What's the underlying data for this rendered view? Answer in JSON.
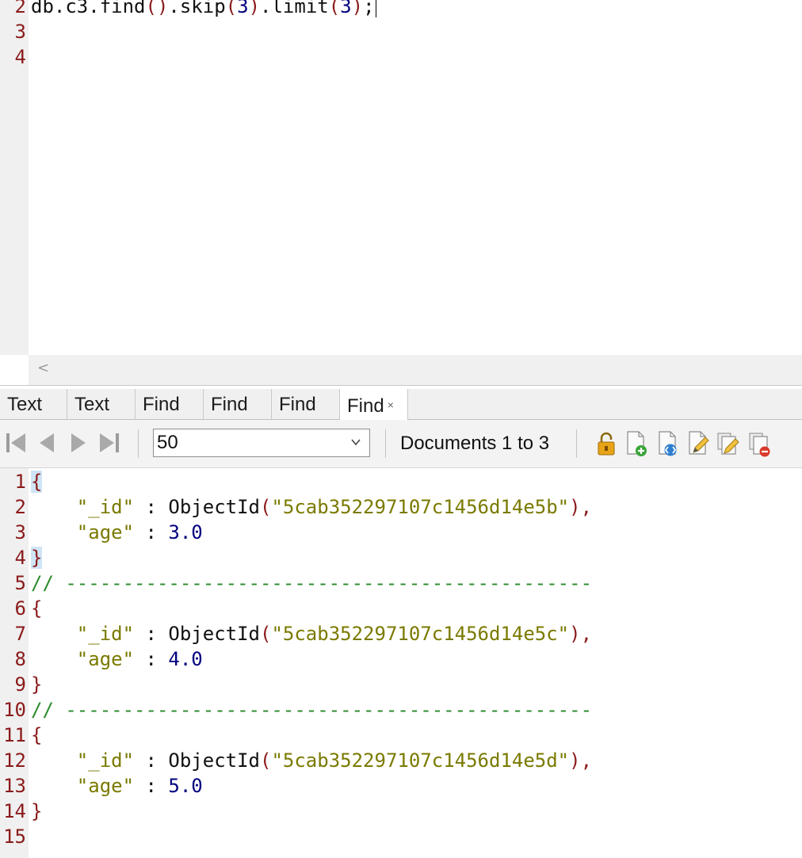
{
  "editor": {
    "lines": [
      {
        "num": "2",
        "parts": [
          {
            "t": "db.c3.find",
            "c": "fn"
          },
          {
            "t": "()",
            "c": "paren"
          },
          {
            "t": ".skip",
            "c": "fn"
          },
          {
            "t": "(",
            "c": "paren"
          },
          {
            "t": "3",
            "c": "num"
          },
          {
            "t": ")",
            "c": "paren"
          },
          {
            "t": ".limit",
            "c": "fn"
          },
          {
            "t": "(",
            "c": "paren"
          },
          {
            "t": "3",
            "c": "num"
          },
          {
            "t": ")",
            "c": "paren"
          },
          {
            "t": ";",
            "c": "punc"
          }
        ]
      },
      {
        "num": "3",
        "parts": []
      },
      {
        "num": "4",
        "parts": []
      }
    ],
    "scroll_left_icon": "chevron-left-icon"
  },
  "tabs": [
    {
      "label": "Text",
      "active": false
    },
    {
      "label": "Text",
      "active": false
    },
    {
      "label": "Find",
      "active": false
    },
    {
      "label": "Find",
      "active": false
    },
    {
      "label": "Find",
      "active": false
    },
    {
      "label": "Find",
      "active": true,
      "close": "×"
    }
  ],
  "toolbar": {
    "nav_icons": [
      "first-page-icon",
      "previous-page-icon",
      "next-page-icon",
      "last-page-icon"
    ],
    "page_size": "50",
    "documents_label": "Documents 1 to 3",
    "action_icons": [
      "lock-icon",
      "add-document-icon",
      "view-document-icon",
      "edit-document-icon",
      "edit-multiple-icon",
      "delete-document-icon"
    ]
  },
  "results": {
    "lines": [
      {
        "num": "1",
        "parts": [
          {
            "t": "{",
            "c": "brace hl"
          }
        ]
      },
      {
        "num": "2",
        "parts": [
          {
            "t": "    ",
            "c": "punc"
          },
          {
            "t": "\"_id\"",
            "c": "key"
          },
          {
            "t": " : ",
            "c": "punc"
          },
          {
            "t": "ObjectId",
            "c": "fn"
          },
          {
            "t": "(",
            "c": "paren"
          },
          {
            "t": "\"5cab352297107c1456d14e5b\"",
            "c": "str"
          },
          {
            "t": "),",
            "c": "paren"
          }
        ]
      },
      {
        "num": "3",
        "parts": [
          {
            "t": "    ",
            "c": "punc"
          },
          {
            "t": "\"age\"",
            "c": "key"
          },
          {
            "t": " : ",
            "c": "punc"
          },
          {
            "t": "3.0",
            "c": "num"
          }
        ]
      },
      {
        "num": "4",
        "parts": [
          {
            "t": "}",
            "c": "brace hl"
          }
        ]
      },
      {
        "num": "5",
        "parts": [
          {
            "t": "// ----------------------------------------------",
            "c": "cmt"
          }
        ]
      },
      {
        "num": "6",
        "parts": [
          {
            "t": "{",
            "c": "brace"
          }
        ]
      },
      {
        "num": "7",
        "parts": [
          {
            "t": "    ",
            "c": "punc"
          },
          {
            "t": "\"_id\"",
            "c": "key"
          },
          {
            "t": " : ",
            "c": "punc"
          },
          {
            "t": "ObjectId",
            "c": "fn"
          },
          {
            "t": "(",
            "c": "paren"
          },
          {
            "t": "\"5cab352297107c1456d14e5c\"",
            "c": "str"
          },
          {
            "t": "),",
            "c": "paren"
          }
        ]
      },
      {
        "num": "8",
        "parts": [
          {
            "t": "    ",
            "c": "punc"
          },
          {
            "t": "\"age\"",
            "c": "key"
          },
          {
            "t": " : ",
            "c": "punc"
          },
          {
            "t": "4.0",
            "c": "num"
          }
        ]
      },
      {
        "num": "9",
        "parts": [
          {
            "t": "}",
            "c": "brace"
          }
        ]
      },
      {
        "num": "10",
        "parts": [
          {
            "t": "// ----------------------------------------------",
            "c": "cmt"
          }
        ]
      },
      {
        "num": "11",
        "parts": [
          {
            "t": "{",
            "c": "brace"
          }
        ]
      },
      {
        "num": "12",
        "parts": [
          {
            "t": "    ",
            "c": "punc"
          },
          {
            "t": "\"_id\"",
            "c": "key"
          },
          {
            "t": " : ",
            "c": "punc"
          },
          {
            "t": "ObjectId",
            "c": "fn"
          },
          {
            "t": "(",
            "c": "paren"
          },
          {
            "t": "\"5cab352297107c1456d14e5d\"",
            "c": "str"
          },
          {
            "t": "),",
            "c": "paren"
          }
        ]
      },
      {
        "num": "13",
        "parts": [
          {
            "t": "    ",
            "c": "punc"
          },
          {
            "t": "\"age\"",
            "c": "key"
          },
          {
            "t": " : ",
            "c": "punc"
          },
          {
            "t": "5.0",
            "c": "num"
          }
        ]
      },
      {
        "num": "14",
        "parts": [
          {
            "t": "}",
            "c": "brace"
          }
        ]
      },
      {
        "num": "15",
        "parts": []
      }
    ]
  }
}
